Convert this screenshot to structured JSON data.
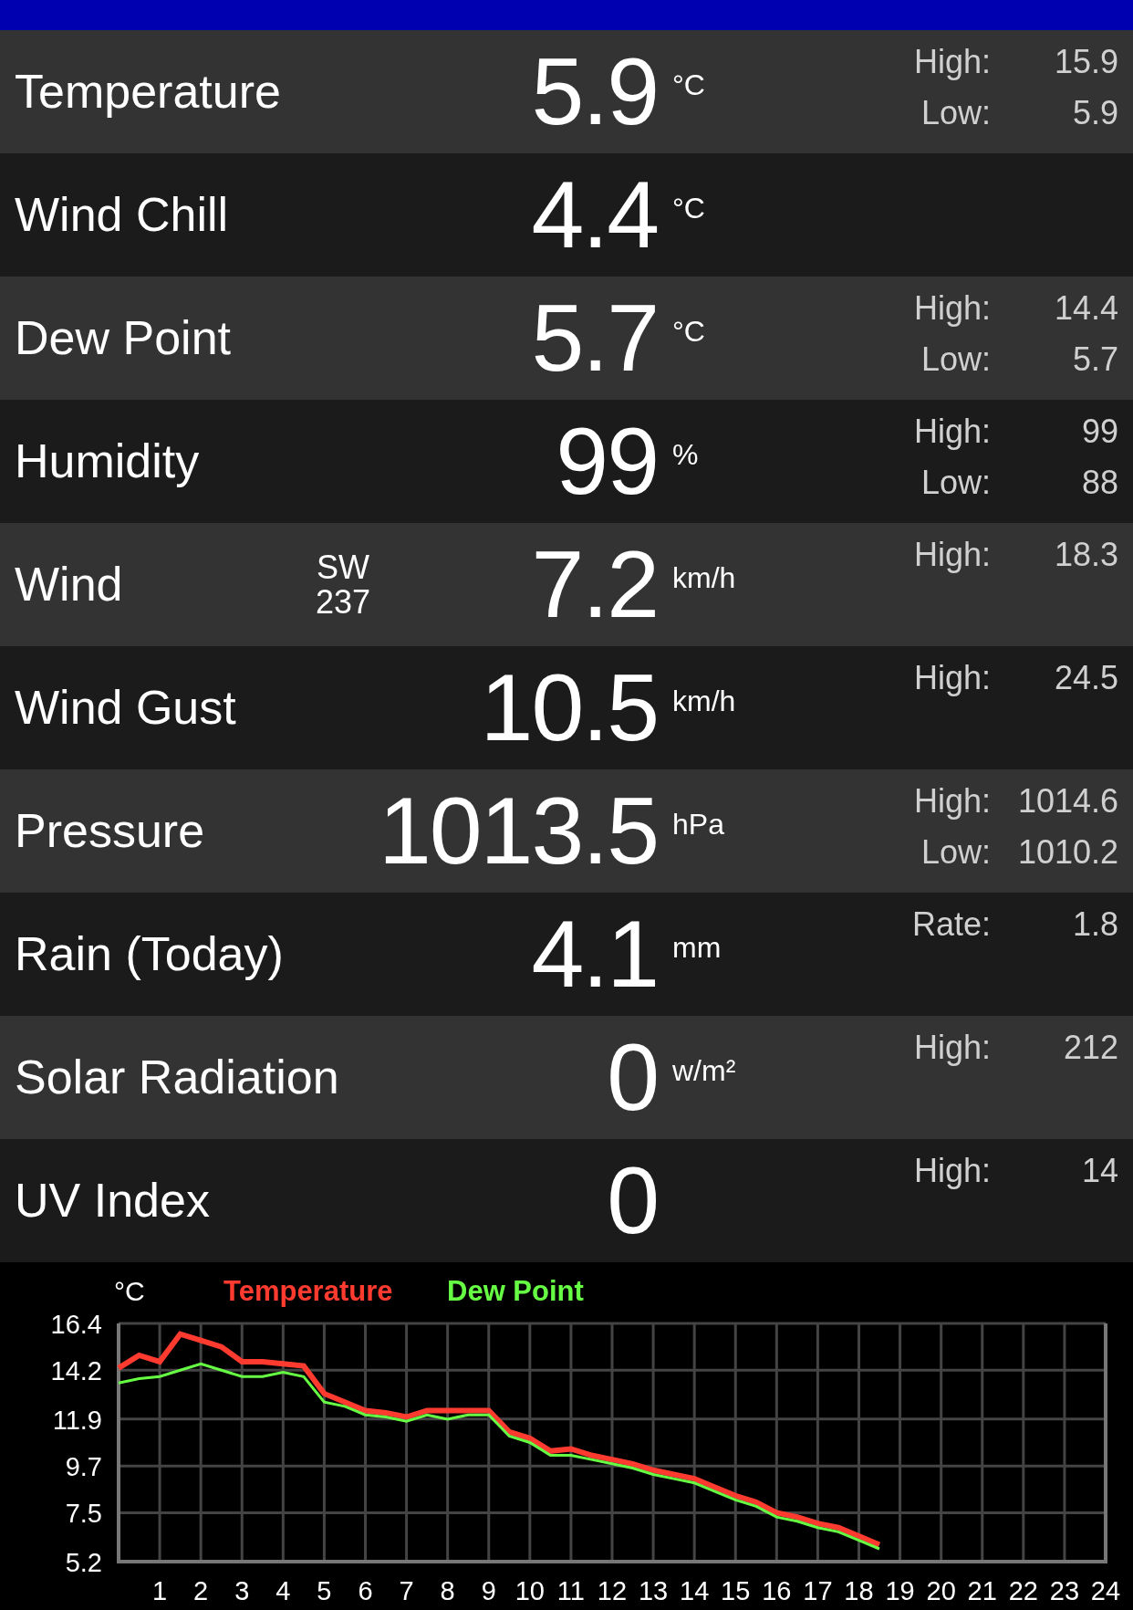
{
  "rows": [
    {
      "label": "Temperature",
      "value": "5.9",
      "unit": "°C",
      "stats": [
        {
          "label": "High:",
          "value": "15.9"
        },
        {
          "label": "Low:",
          "value": "5.9"
        }
      ]
    },
    {
      "label": "Wind Chill",
      "value": "4.4",
      "unit": "°C",
      "stats": []
    },
    {
      "label": "Dew Point",
      "value": "5.7",
      "unit": "°C",
      "stats": [
        {
          "label": "High:",
          "value": "14.4"
        },
        {
          "label": "Low:",
          "value": "5.7"
        }
      ]
    },
    {
      "label": "Humidity",
      "value": "99",
      "unit": "%",
      "stats": [
        {
          "label": "High:",
          "value": "99"
        },
        {
          "label": "Low:",
          "value": "88"
        }
      ]
    },
    {
      "label": "Wind",
      "direction": [
        "SW",
        "237"
      ],
      "value": "7.2",
      "unit": "km/h",
      "stats": [
        {
          "label": "High:",
          "value": "18.3"
        }
      ]
    },
    {
      "label": "Wind Gust",
      "value": "10.5",
      "unit": "km/h",
      "stats": [
        {
          "label": "High:",
          "value": "24.5"
        }
      ]
    },
    {
      "label": "Pressure",
      "value": "1013.5",
      "unit": "hPa",
      "stats": [
        {
          "label": "High:",
          "value": "1014.6"
        },
        {
          "label": "Low:",
          "value": "1010.2"
        }
      ]
    },
    {
      "label": "Rain (Today)",
      "value": "4.1",
      "unit": "mm",
      "stats": [
        {
          "label": "Rate:",
          "value": "1.8"
        }
      ]
    },
    {
      "label": "Solar Radiation",
      "value": "0",
      "unit": "w/m²",
      "stats": [
        {
          "label": "High:",
          "value": "212"
        }
      ]
    },
    {
      "label": "UV Index",
      "value": "0",
      "stats": [
        {
          "label": "High:",
          "value": "14"
        }
      ]
    }
  ],
  "chart": {
    "chart_data": {
      "type": "line",
      "ylabel": "°C",
      "x": [
        0,
        0.5,
        1,
        1.5,
        2,
        2.5,
        3,
        3.5,
        4,
        4.5,
        5,
        5.5,
        6,
        6.5,
        7,
        7.5,
        8,
        8.5,
        9,
        9.5,
        10,
        10.5,
        11,
        11.5,
        12,
        12.5,
        13,
        13.5,
        14,
        14.5,
        15,
        15.5,
        16,
        16.5,
        17,
        17.5,
        18,
        18.5
      ],
      "series": [
        {
          "name": "Temperature",
          "color": "#ff3b30",
          "values": [
            14.3,
            14.9,
            14.6,
            15.9,
            15.6,
            15.3,
            14.6,
            14.6,
            14.5,
            14.4,
            13.1,
            12.7,
            12.3,
            12.2,
            12.0,
            12.3,
            12.3,
            12.3,
            12.3,
            11.3,
            11.0,
            10.4,
            10.5,
            10.2,
            10.0,
            9.8,
            9.5,
            9.3,
            9.1,
            8.7,
            8.3,
            8.0,
            7.5,
            7.3,
            7.0,
            6.8,
            6.4,
            6.0
          ]
        },
        {
          "name": "Dew Point",
          "color": "#66ff44",
          "values": [
            13.6,
            13.8,
            13.9,
            14.2,
            14.5,
            14.2,
            13.9,
            13.9,
            14.1,
            13.9,
            12.7,
            12.5,
            12.1,
            12.0,
            11.8,
            12.1,
            11.9,
            12.1,
            12.1,
            11.1,
            10.8,
            10.2,
            10.2,
            10.0,
            9.8,
            9.6,
            9.3,
            9.1,
            8.9,
            8.5,
            8.1,
            7.8,
            7.3,
            7.1,
            6.8,
            6.6,
            6.2,
            5.8
          ]
        }
      ],
      "xlim": [
        0,
        24
      ],
      "ylim": [
        5.2,
        16.4
      ],
      "xticks": [
        1,
        2,
        3,
        4,
        5,
        6,
        7,
        8,
        9,
        10,
        11,
        12,
        13,
        14,
        15,
        16,
        17,
        18,
        19,
        20,
        21,
        22,
        23,
        24
      ],
      "yticks": [
        5.2,
        7.5,
        9.7,
        11.9,
        14.2,
        16.4
      ],
      "grid": true
    }
  }
}
